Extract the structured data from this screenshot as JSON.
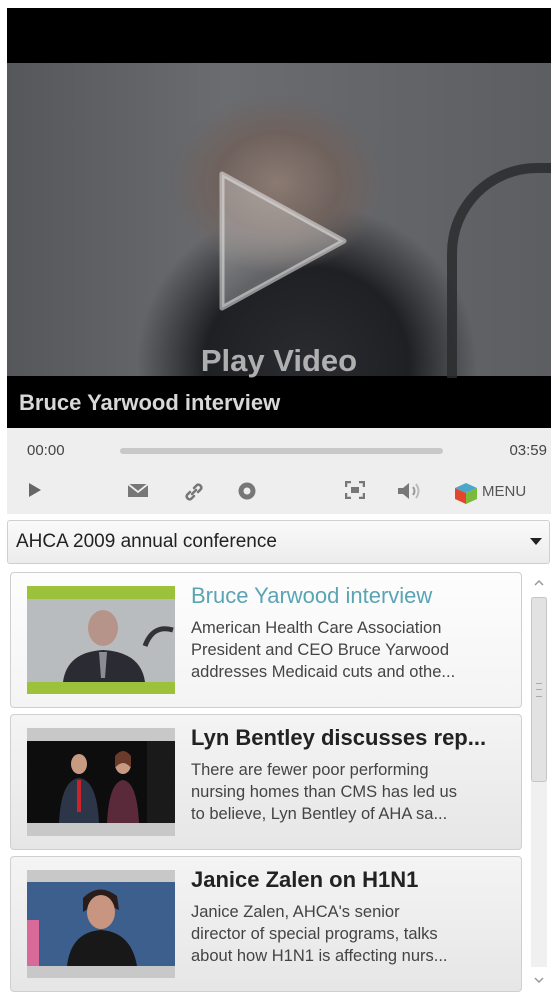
{
  "player": {
    "play_label": "Play Video",
    "video_title": "Bruce Yarwood interview",
    "current_time": "00:00",
    "total_time": "03:59",
    "progress": 0,
    "menu_label": "MENU"
  },
  "playlist": {
    "selected": "AHCA 2009 annual conference"
  },
  "items": [
    {
      "title": "Bruce Yarwood interview",
      "desc": [
        "American Health Care Association",
        "President and CEO Bruce Yarwood",
        "addresses Medicaid cuts and othe..."
      ],
      "active": true
    },
    {
      "title": "Lyn Bentley discusses rep...",
      "desc": [
        "There are fewer poor performing",
        "nursing homes than CMS has led us",
        "to believe, Lyn Bentley of AHA sa..."
      ],
      "active": false
    },
    {
      "title": "Janice Zalen on H1N1",
      "desc": [
        "Janice Zalen, AHCA's senior",
        "director of special programs, talks",
        "about how H1N1 is affecting nurs..."
      ],
      "active": false
    }
  ],
  "colors": {
    "accent_title": "#5aa4b4",
    "thumb_green": "#9cc23c"
  }
}
